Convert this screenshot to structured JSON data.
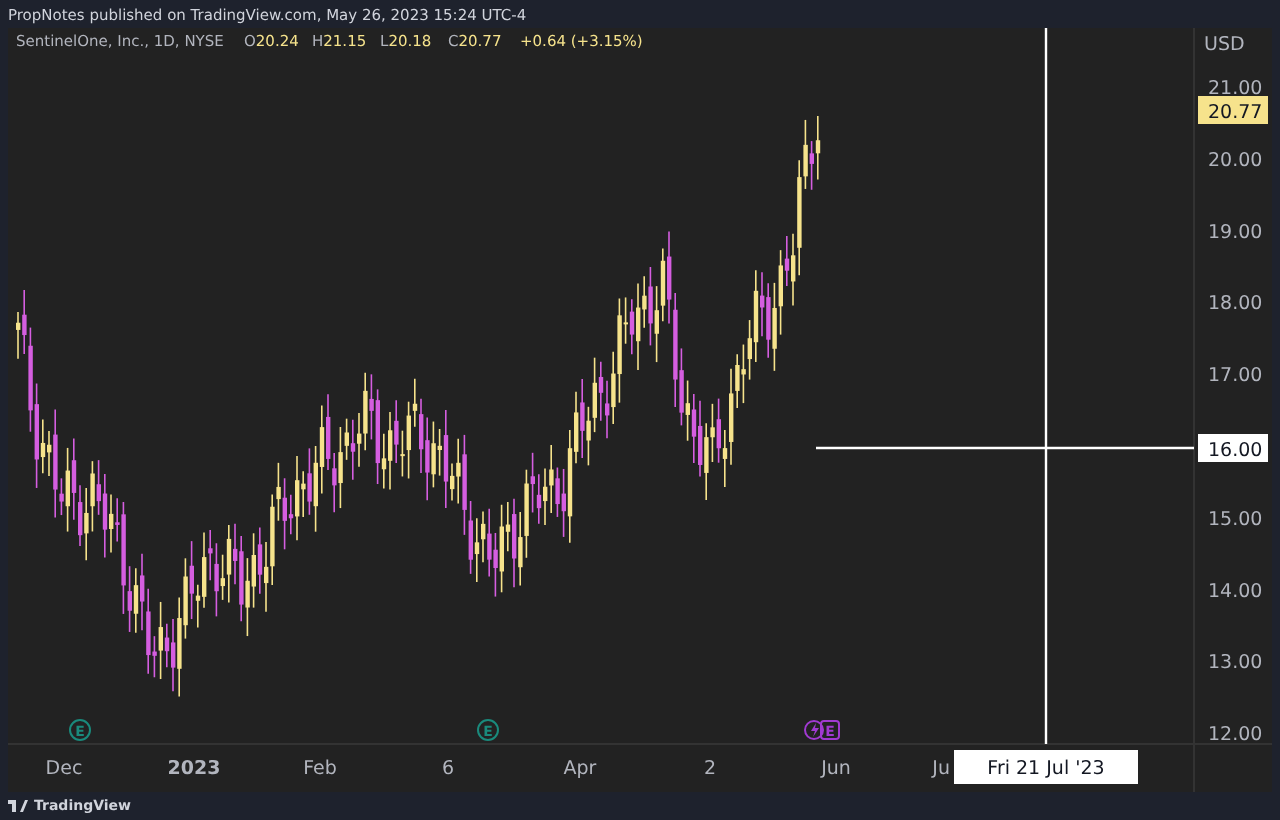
{
  "header": {
    "text": "PropNotes published on TradingView.com, May 26, 2023 15:24 UTC-4"
  },
  "legend": {
    "symbol": "SentinelOne, Inc., 1D, NYSE",
    "values": [
      {
        "letter": "O",
        "value": "20.24"
      },
      {
        "letter": "H",
        "value": "21.15"
      },
      {
        "letter": "L",
        "value": "20.18"
      },
      {
        "letter": "C",
        "value": "20.77"
      }
    ],
    "change": "+0.64 (+3.15%)"
  },
  "price_axis": {
    "currency": "USD",
    "ticks": [
      "21.00",
      "20.00",
      "19.00",
      "18.00",
      "17.00",
      "15.00",
      "14.00",
      "13.00",
      "12.00"
    ],
    "last_price": "20.77"
  },
  "time_axis": {
    "ticks": [
      {
        "label": "Dec",
        "bold": false
      },
      {
        "label": "2023",
        "bold": true
      },
      {
        "label": "Feb",
        "bold": false
      },
      {
        "label": "6",
        "bold": false
      },
      {
        "label": "Apr",
        "bold": false
      },
      {
        "label": "2",
        "bold": false
      },
      {
        "label": "Jun",
        "bold": false
      },
      {
        "label": "Ju",
        "bold": false
      }
    ]
  },
  "crosshair": {
    "price": "16.00",
    "date": "Fri 21 Jul '23"
  },
  "events": [
    {
      "kind": "earnings",
      "label": "E"
    },
    {
      "kind": "earnings",
      "label": "E"
    },
    {
      "kind": "upcoming",
      "label": "E"
    }
  ],
  "footer": {
    "brand": "TradingView"
  }
}
